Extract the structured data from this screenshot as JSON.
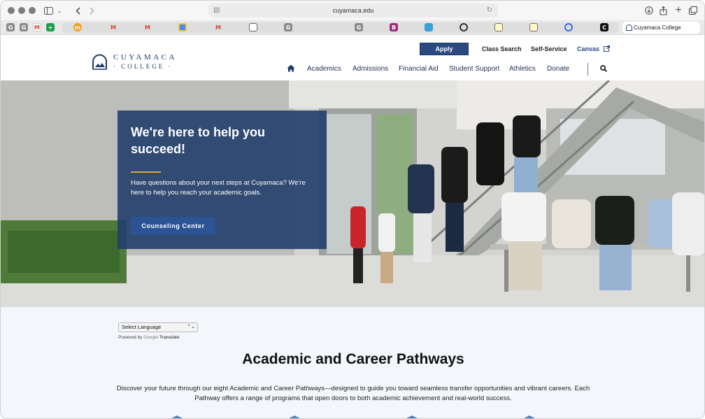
{
  "browser": {
    "url": "cuyamaca.edu",
    "active_tab_title": "Cuyamaca College",
    "tab_favicons": [
      "G",
      "G",
      "M",
      "+",
      "m",
      "M",
      "M",
      "",
      "M",
      "",
      "G",
      "",
      "G",
      "B",
      "",
      "",
      "",
      "",
      "",
      "C"
    ]
  },
  "header": {
    "logo_line1": "CUYAMACA",
    "logo_line2": "· COLLEGE ·",
    "apply_label": "Apply",
    "class_search_label": "Class Search",
    "self_service_label": "Self-Service",
    "canvas_label": "Canvas",
    "nav": {
      "academics": "Academics",
      "admissions": "Admissions",
      "financial_aid": "Financial Aid",
      "student_support": "Student Support",
      "athletics": "Athletics",
      "donate": "Donate"
    }
  },
  "hero": {
    "title": "We're here to help you succeed!",
    "text": "Have questions about your next steps at Cuyamaca? We're here to help you reach your academic goals.",
    "button_label": "Counseling Center"
  },
  "translate": {
    "select_value": "Select Language",
    "powered_by": "Powered by",
    "google": "Google",
    "translate_label": "Translate"
  },
  "pathways": {
    "title": "Academic and Career Pathways",
    "text": "Discover your future through our eight Academic and Career Pathways—designed to guide you toward seamless transfer opportunities and vibrant careers. Each Pathway offers a range of programs that open doors to both academic achievement and real-world success."
  },
  "colors": {
    "brand_navy": "#1f3a66",
    "apply_blue": "#2a4a80",
    "hero_card": "#213e6b",
    "accent_gold": "#e0a23b",
    "button_blue": "#2c5394"
  }
}
